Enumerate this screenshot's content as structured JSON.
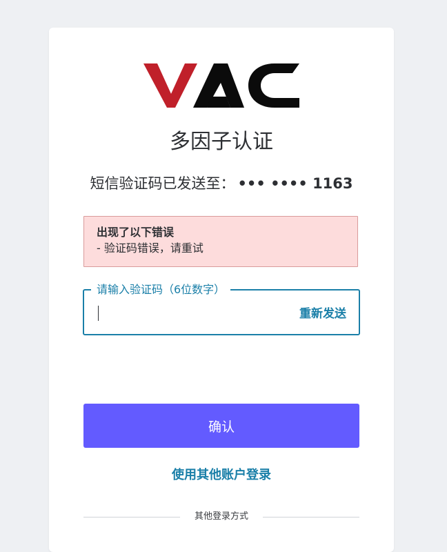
{
  "brand": {
    "logo_text": "VAC",
    "colors": {
      "logo_red": "#c0202a",
      "logo_black": "#0b0b0b"
    }
  },
  "page": {
    "title": "多因子认证",
    "sms_prefix": "短信验证码已发送至：",
    "sms_masked_phone": "••• •••• 1163"
  },
  "error": {
    "title": "出现了以下错误",
    "items": [
      "- 验证码错误，请重试"
    ],
    "colors": {
      "background": "#fddcdc",
      "border": "#d99a9a"
    }
  },
  "code_field": {
    "label": "请输入验证码（6位数字）",
    "value": "",
    "resend_label": "重新发送",
    "accent_color": "#1a7fa8"
  },
  "actions": {
    "confirm_label": "确认",
    "confirm_color": "#635bff",
    "other_account_label": "使用其他账户登录"
  },
  "other_login": {
    "divider_text": "其他登录方式"
  }
}
